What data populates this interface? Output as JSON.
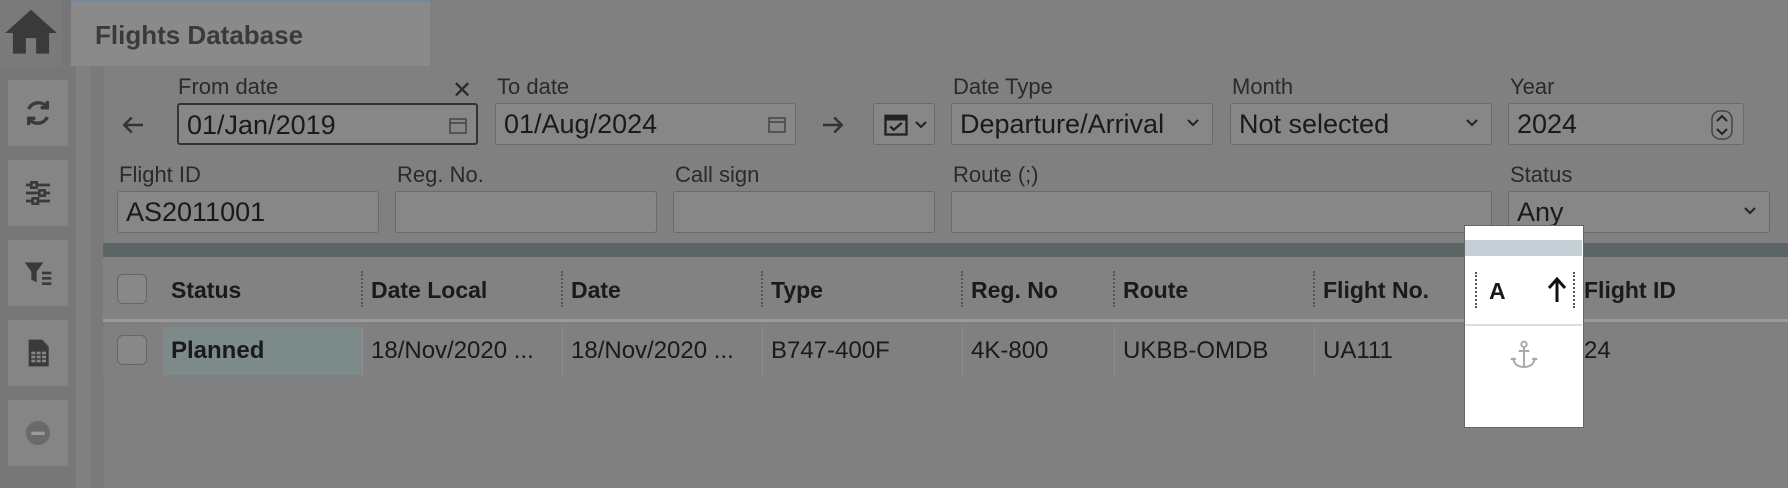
{
  "header": {
    "title": "Flights Database"
  },
  "sidebar": {
    "items": [
      {
        "name": "home",
        "icon": "home-icon"
      },
      {
        "name": "refresh",
        "icon": "refresh-icon"
      },
      {
        "name": "settings",
        "icon": "sliders-icon"
      },
      {
        "name": "filter",
        "icon": "filter-icon"
      },
      {
        "name": "report",
        "icon": "spreadsheet-icon"
      },
      {
        "name": "remove",
        "icon": "minus-circle-icon"
      }
    ]
  },
  "filters": {
    "from_date": {
      "label": "From date",
      "value": "01/Jan/2019"
    },
    "to_date": {
      "label": "To date",
      "value": "01/Aug/2024"
    },
    "date_type": {
      "label": "Date Type",
      "value": "Departure/Arrival"
    },
    "month": {
      "label": "Month",
      "value": "Not selected"
    },
    "year": {
      "label": "Year",
      "value": "2024"
    },
    "flight_id": {
      "label": "Flight ID",
      "value": "AS2011001"
    },
    "reg_no": {
      "label": "Reg. No.",
      "value": ""
    },
    "call_sign": {
      "label": "Call sign",
      "value": ""
    },
    "route": {
      "label": "Route (;)",
      "value": ""
    },
    "status": {
      "label": "Status",
      "value": "Any"
    }
  },
  "grid": {
    "columns": [
      "Status",
      "Date Local",
      "Date",
      "Type",
      "Reg. No",
      "Route",
      "Flight No.",
      "A",
      "Flight ID"
    ],
    "rows": [
      {
        "status": "Planned",
        "date_local": "18/Nov/2020 ...",
        "date": "18/Nov/2020 ...",
        "type": "B747-400F",
        "reg_no": "4K-800",
        "route": "UKBB-OMDB",
        "flight_no": "UA111",
        "a_icon": "anchor-icon",
        "flight_id": "24"
      }
    ]
  },
  "colors": {
    "accent": "#6f8aa0",
    "status_cell": "#7d8a8a"
  }
}
